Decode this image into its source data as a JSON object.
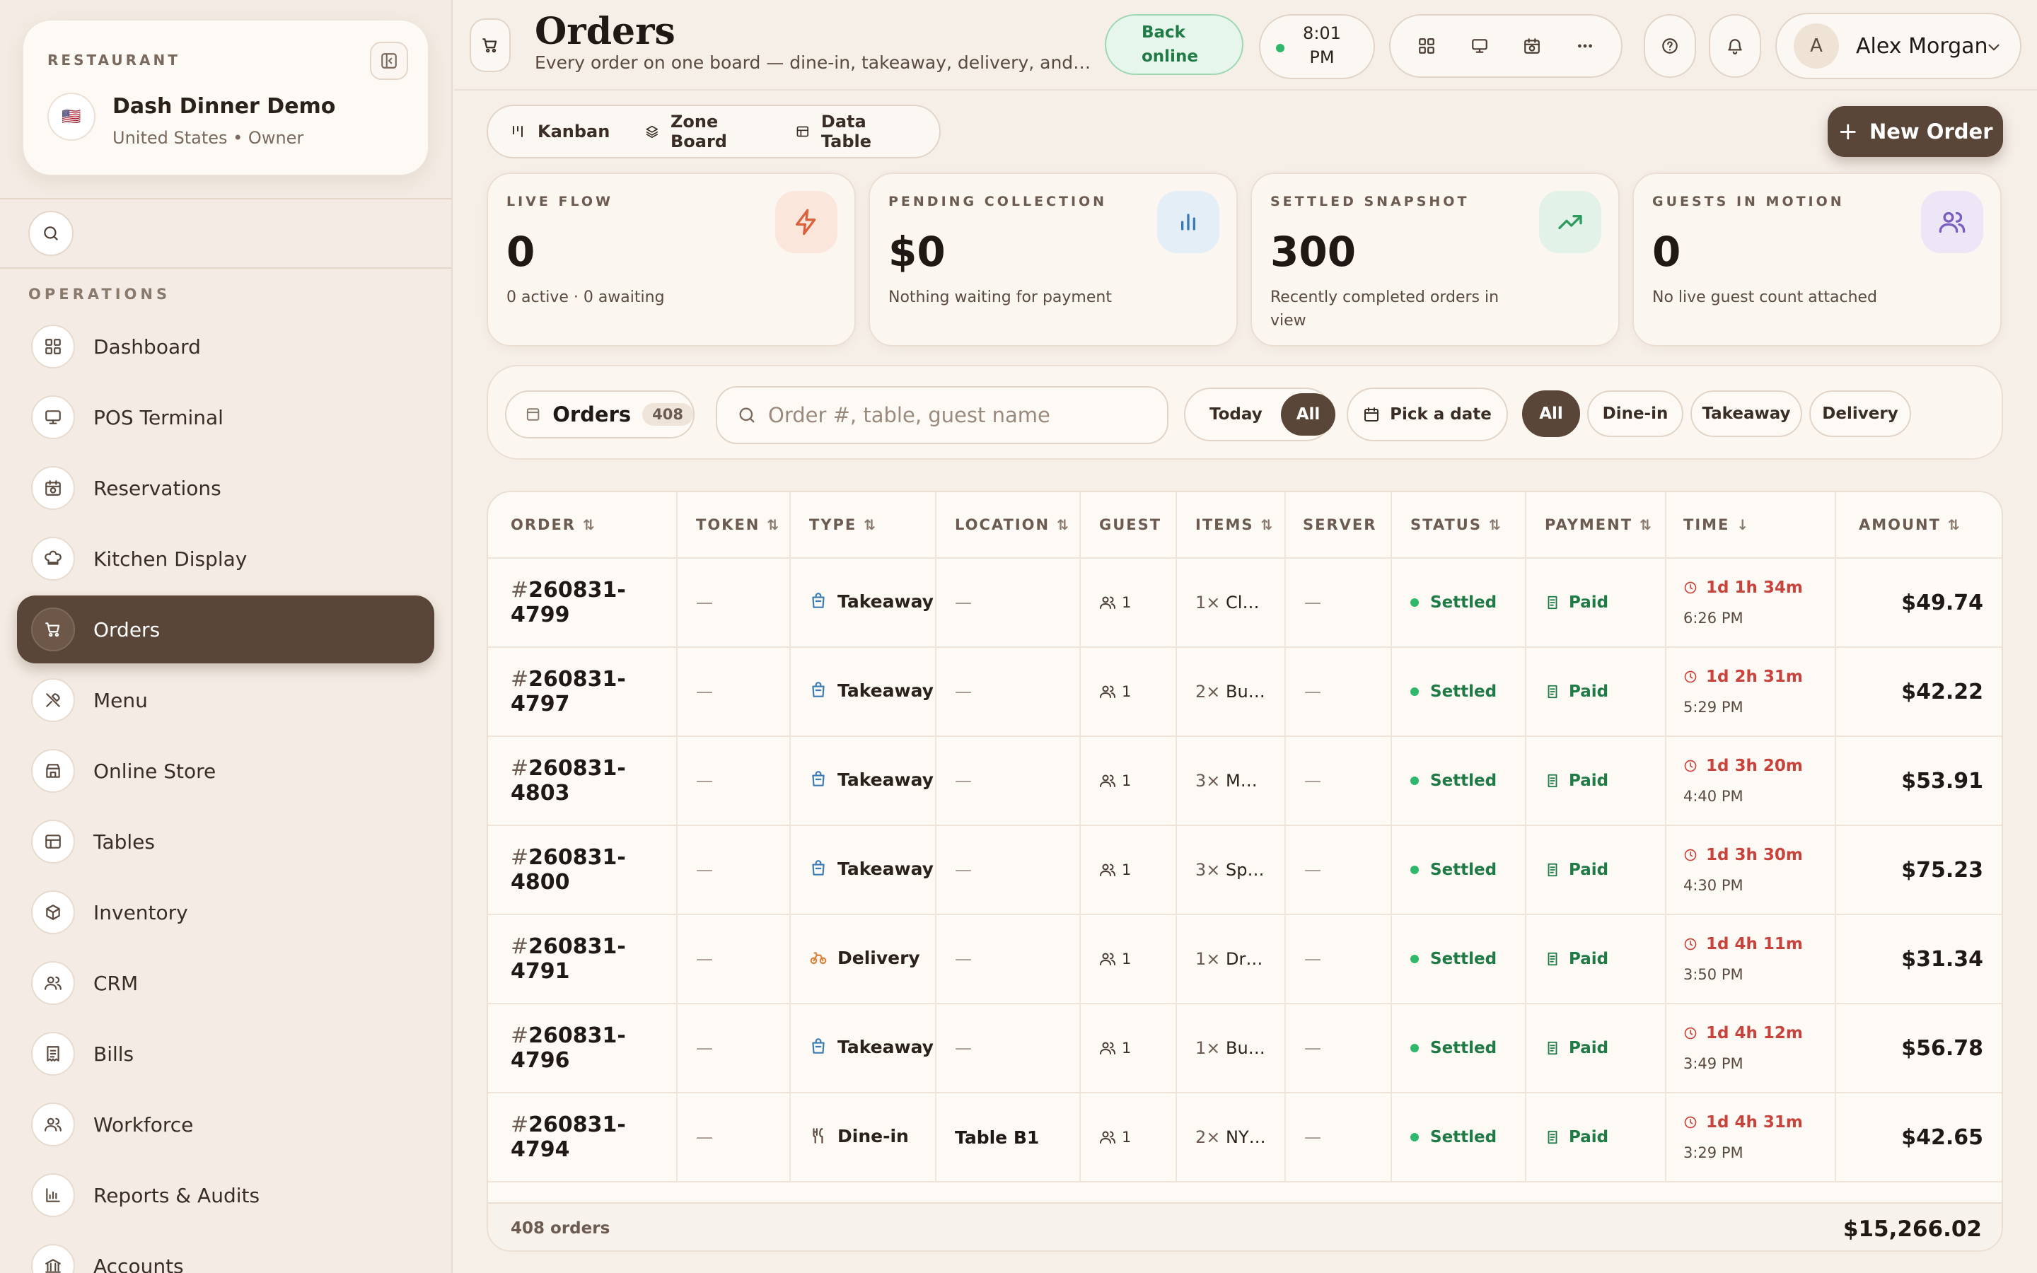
{
  "sidebar": {
    "restaurant_label": "RESTAURANT",
    "flag": "🇺🇸",
    "restaurant_name": "Dash Dinner Demo",
    "restaurant_sub": "United States • Owner",
    "section_label": "OPERATIONS",
    "items": [
      {
        "label": "Dashboard",
        "icon": "grid-icon"
      },
      {
        "label": "POS Terminal",
        "icon": "monitor-icon"
      },
      {
        "label": "Reservations",
        "icon": "calendar-clock-icon"
      },
      {
        "label": "Kitchen Display",
        "icon": "chef-hat-icon"
      },
      {
        "label": "Orders",
        "icon": "cart-icon",
        "active": true
      },
      {
        "label": "Menu",
        "icon": "utensils-icon"
      },
      {
        "label": "Online Store",
        "icon": "store-icon"
      },
      {
        "label": "Tables",
        "icon": "table-icon"
      },
      {
        "label": "Inventory",
        "icon": "box-icon"
      },
      {
        "label": "CRM",
        "icon": "users-icon"
      },
      {
        "label": "Bills",
        "icon": "receipt-icon"
      },
      {
        "label": "Workforce",
        "icon": "users-icon"
      },
      {
        "label": "Reports & Audits",
        "icon": "bar-chart-icon"
      },
      {
        "label": "Accounts",
        "icon": "bank-icon"
      }
    ]
  },
  "header": {
    "title": "Orders",
    "subtitle": "Every order on one board — dine-in, takeaway, delivery, and online orders.",
    "online_status": "Back online",
    "clock": "8:01 PM",
    "user_initial": "A",
    "user_name": "Alex Morgan"
  },
  "views": {
    "tabs": [
      "Kanban",
      "Zone Board",
      "Data Table"
    ],
    "new_order_label": "New Order"
  },
  "metrics": [
    {
      "label": "LIVE FLOW",
      "value": "0",
      "sub": "0 active · 0 awaiting",
      "icon": "zap-icon",
      "color": "#d9623c",
      "bg": "#fbe6dc"
    },
    {
      "label": "PENDING COLLECTION",
      "value": "$0",
      "sub": "Nothing waiting for payment",
      "icon": "bar-chart-icon",
      "color": "#3b7bb5",
      "bg": "#e4eef7"
    },
    {
      "label": "SETTLED SNAPSHOT",
      "value": "300",
      "sub": "Recently completed orders in view",
      "icon": "trending-up-icon",
      "color": "#2f9a5e",
      "bg": "#e2f2e8"
    },
    {
      "label": "GUESTS IN MOTION",
      "value": "0",
      "sub": "No live guest count attached",
      "icon": "users-icon",
      "color": "#7b5fc0",
      "bg": "#ece6f7"
    }
  ],
  "filters": {
    "orders_label": "Orders",
    "orders_count": "408",
    "search_placeholder": "Order #, table, guest name",
    "range_options": [
      "Today",
      "All"
    ],
    "range_selected": "All",
    "date_label": "Pick a date",
    "type_options": [
      "All",
      "Dine-in",
      "Takeaway",
      "Delivery"
    ],
    "type_selected": "All"
  },
  "table": {
    "columns": [
      "ORDER",
      "TOKEN",
      "TYPE",
      "LOCATION",
      "GUEST",
      "ITEMS",
      "SERVER",
      "STATUS",
      "PAYMENT",
      "TIME",
      "AMOUNT"
    ],
    "rows": [
      {
        "order": "260831-4799",
        "token": "—",
        "type": "Takeaway",
        "location": "—",
        "guest": "1",
        "items_qty": "1×",
        "items": "Cla...",
        "server": "—",
        "status": "Settled",
        "payment": "Paid",
        "elapsed": "1d 1h 34m",
        "time": "6:26 PM",
        "amount": "$49.74"
      },
      {
        "order": "260831-4797",
        "token": "—",
        "type": "Takeaway",
        "location": "—",
        "guest": "1",
        "items_qty": "2×",
        "items": "Buil...",
        "server": "—",
        "status": "Settled",
        "payment": "Paid",
        "elapsed": "1d 2h 31m",
        "time": "5:29 PM",
        "amount": "$42.22"
      },
      {
        "order": "260831-4803",
        "token": "—",
        "type": "Takeaway",
        "location": "—",
        "guest": "1",
        "items_qty": "3×",
        "items": "Mu...",
        "server": "—",
        "status": "Settled",
        "payment": "Paid",
        "elapsed": "1d 3h 20m",
        "time": "4:40 PM",
        "amount": "$53.91"
      },
      {
        "order": "260831-4800",
        "token": "—",
        "type": "Takeaway",
        "location": "—",
        "guest": "1",
        "items_qty": "3×",
        "items": "Spi...",
        "server": "—",
        "status": "Settled",
        "payment": "Paid",
        "elapsed": "1d 3h 30m",
        "time": "4:30 PM",
        "amount": "$75.23"
      },
      {
        "order": "260831-4791",
        "token": "—",
        "type": "Delivery",
        "location": "—",
        "guest": "1",
        "items_qty": "1×",
        "items": "Dri...",
        "server": "—",
        "status": "Settled",
        "payment": "Paid",
        "elapsed": "1d 4h 11m",
        "time": "3:50 PM",
        "amount": "$31.34"
      },
      {
        "order": "260831-4796",
        "token": "—",
        "type": "Takeaway",
        "location": "—",
        "guest": "1",
        "items_qty": "1×",
        "items": "Buf...",
        "server": "—",
        "status": "Settled",
        "payment": "Paid",
        "elapsed": "1d 4h 12m",
        "time": "3:49 PM",
        "amount": "$56.78"
      },
      {
        "order": "260831-4794",
        "token": "—",
        "type": "Dine-in",
        "location": "Table B1",
        "guest": "1",
        "items_qty": "2×",
        "items": "NY ...",
        "server": "—",
        "status": "Settled",
        "payment": "Paid",
        "elapsed": "1d 4h 31m",
        "time": "3:29 PM",
        "amount": "$42.65"
      }
    ],
    "footer_count": "408 orders",
    "footer_total": "$15,266.02"
  }
}
